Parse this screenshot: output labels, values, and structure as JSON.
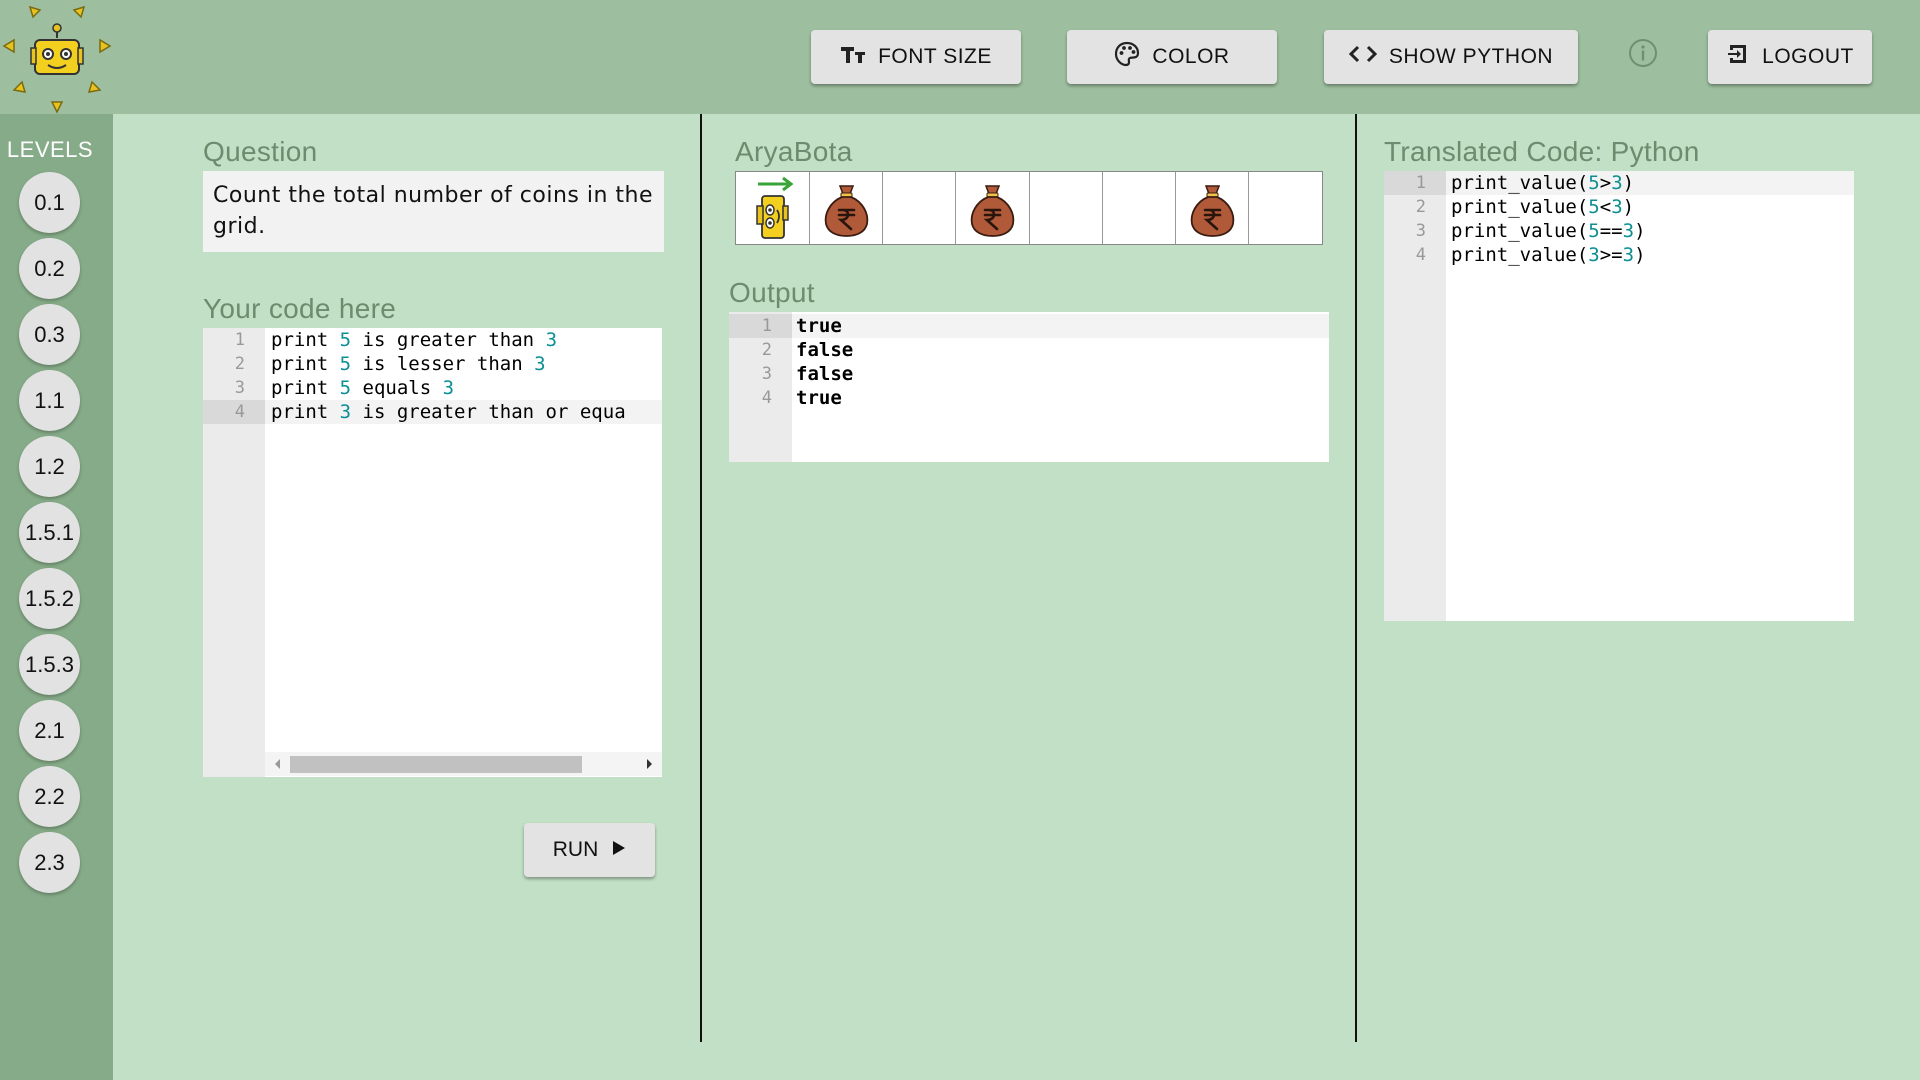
{
  "header": {
    "font_size_label": "FONT SIZE",
    "color_label": "COLOR",
    "show_python_label": "SHOW PYTHON",
    "logout_label": "LOGOUT"
  },
  "sidebar": {
    "title": "LEVELS",
    "levels": [
      "0.1",
      "0.2",
      "0.3",
      "1.1",
      "1.2",
      "1.5.1",
      "1.5.2",
      "1.5.3",
      "2.1",
      "2.2",
      "2.3"
    ]
  },
  "question": {
    "title": "Question",
    "text": "Count the total number of coins in the grid."
  },
  "editor": {
    "title": "Your code here",
    "lines": [
      {
        "n": "1",
        "segs": [
          [
            "print ",
            ""
          ],
          [
            "5",
            "num"
          ],
          [
            " is greater than ",
            ""
          ],
          [
            "3",
            "num"
          ]
        ]
      },
      {
        "n": "2",
        "segs": [
          [
            "print ",
            ""
          ],
          [
            "5",
            "num"
          ],
          [
            " is lesser than ",
            ""
          ],
          [
            "3",
            "num"
          ]
        ]
      },
      {
        "n": "3",
        "segs": [
          [
            "print ",
            ""
          ],
          [
            "5",
            "num"
          ],
          [
            " equals ",
            ""
          ],
          [
            "3",
            "num"
          ]
        ]
      },
      {
        "n": "4",
        "segs": [
          [
            "print ",
            ""
          ],
          [
            "3",
            "num"
          ],
          [
            " is greater than or equa",
            ""
          ]
        ]
      }
    ],
    "run_label": "RUN"
  },
  "game": {
    "title": "AryaBota",
    "cells": [
      "robot",
      "coin",
      "empty",
      "coin",
      "empty",
      "empty",
      "coin",
      "empty"
    ]
  },
  "output": {
    "title": "Output",
    "lines": [
      {
        "n": "1",
        "text": "true"
      },
      {
        "n": "2",
        "text": "false"
      },
      {
        "n": "3",
        "text": "false"
      },
      {
        "n": "4",
        "text": "true"
      }
    ]
  },
  "translated": {
    "title": "Translated Code: Python",
    "lines": [
      {
        "n": "1",
        "segs": [
          [
            "print_value(",
            ""
          ],
          [
            "5",
            "num"
          ],
          [
            ">",
            ""
          ],
          [
            "3",
            "num"
          ],
          [
            ")",
            ""
          ]
        ]
      },
      {
        "n": "2",
        "segs": [
          [
            "print_value(",
            ""
          ],
          [
            "5",
            "num"
          ],
          [
            "<",
            ""
          ],
          [
            "3",
            "num"
          ],
          [
            ")",
            ""
          ]
        ]
      },
      {
        "n": "3",
        "segs": [
          [
            "print_value(",
            ""
          ],
          [
            "5",
            "num"
          ],
          [
            "==",
            ""
          ],
          [
            "3",
            "num"
          ],
          [
            ")",
            ""
          ]
        ]
      },
      {
        "n": "4",
        "segs": [
          [
            "print_value(",
            ""
          ],
          [
            "3",
            "num"
          ],
          [
            ">=",
            ""
          ],
          [
            "3",
            "num"
          ],
          [
            ")",
            ""
          ]
        ]
      }
    ]
  },
  "colors": {
    "header_bg": "#9dbf9f",
    "sidebar_bg": "#86ab88",
    "main_bg": "#c2e0c5",
    "number_token": "#0b8f94",
    "coin_bag": "#b05a3a"
  }
}
